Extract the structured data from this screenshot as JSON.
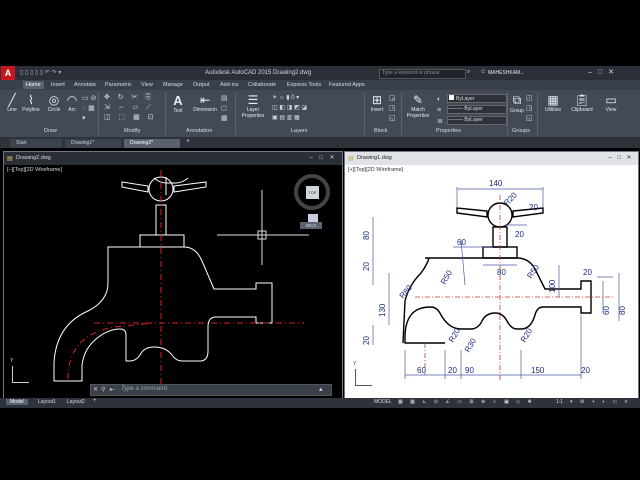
{
  "title": "Autodesk AutoCAD 2015    Drawing2.dwg",
  "search_placeholder": "Type a keyword or phrase",
  "user": "MAHESHKAM...",
  "tabs": [
    "Home",
    "Insert",
    "Annotate",
    "Parametric",
    "View",
    "Manage",
    "Output",
    "Add-ins",
    "Collaborate",
    "Express Tools",
    "Featured Apps"
  ],
  "tools": {
    "line": "Line",
    "polyline": "Polyline",
    "circle": "Circle",
    "arc": "Arc",
    "text": "Text",
    "dimension": "Dimension",
    "layer_properties": "Layer\nProperties",
    "insert": "Insert",
    "match_properties": "Match\nProperties",
    "group": "Group",
    "utilities": "Utilities",
    "clipboard": "Clipboard",
    "view": "View",
    "bylayer": "ByLayer"
  },
  "panels": [
    "Draw",
    "Modify",
    "Annotation",
    "Layers",
    "Block",
    "Properties",
    "Groups"
  ],
  "doc_tabs": [
    "Start",
    "Drawing1*",
    "Drawing2*"
  ],
  "left_window": {
    "title": "Drawing2.dwg",
    "viewport_label": "[–][Top][2D Wireframe]",
    "viewcube_label": "TOP",
    "wcs": "WCS",
    "command_placeholder": "Type a command"
  },
  "right_window": {
    "title": "Drawing1.dwg",
    "viewport_label": "[+][Top][2D Wireframe]"
  },
  "layout_tabs": [
    "Model",
    "Layout1",
    "Layout2"
  ],
  "status": {
    "model": "MODEL",
    "scale": "1:1"
  },
  "dims": {
    "top": "140",
    "r20_top": "R20",
    "d20a": "20",
    "d20b": "20",
    "d80_left": "80",
    "d60": "60",
    "d80": "80",
    "d20c": "20",
    "r50a": "R50",
    "r50b": "R50",
    "d100": "100",
    "d130": "130",
    "r80": "R80",
    "d20d": "20",
    "r20a": "R20",
    "r30": "R30",
    "r20b": "R20",
    "d60_right": "60",
    "d80_right": "80",
    "d20e": "20",
    "b60": "60",
    "b20": "20",
    "b90": "90",
    "b150": "150",
    "b20r": "20"
  }
}
